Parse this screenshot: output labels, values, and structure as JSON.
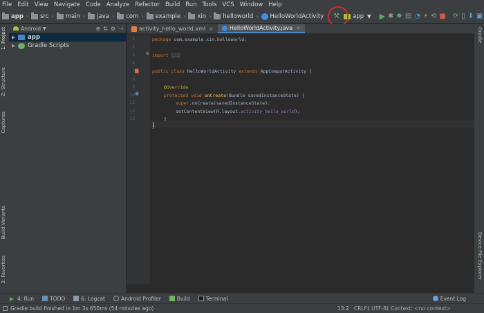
{
  "menu": [
    "File",
    "Edit",
    "View",
    "Navigate",
    "Code",
    "Analyze",
    "Refactor",
    "Build",
    "Run",
    "Tools",
    "VCS",
    "Window",
    "Help"
  ],
  "breadcrumb": [
    "app",
    "src",
    "main",
    "java",
    "com",
    "example",
    "xin",
    "helloworld",
    "HelloWorldActivity"
  ],
  "run_config": "app",
  "project_panel": {
    "view_mode": "Android",
    "items": [
      {
        "label": "app",
        "selected": true
      },
      {
        "label": "Gradle Scripts",
        "selected": false
      }
    ]
  },
  "left_tabs": [
    "1: Project",
    "Z: Structure",
    "Captures",
    "Build Variants",
    "2: Favorites"
  ],
  "right_tabs": [
    "Gradle",
    "Device File Explorer"
  ],
  "editor_tabs": [
    {
      "label": "activity_hello_world.xml",
      "active": false
    },
    {
      "label": "HelloWorldActivity.java",
      "active": true
    }
  ],
  "line_numbers": [
    "1",
    "2",
    "3",
    "6",
    "7",
    "8",
    "9",
    "10",
    "11",
    "12",
    "13"
  ],
  "code": {
    "l1_kw": "package",
    "l1_rest": " com.example.xin.helloworld;",
    "l3_kw": "import",
    "l3_fold": "...",
    "l6_kw": "public class",
    "l6_rest1": " HelloWorldActivity ",
    "l6_kw2": "extends",
    "l6_rest2": " AppCompatActivity {",
    "l8_ann": "@Override",
    "l9_kw": "protected void",
    "l9_fn": "onCreate",
    "l9_rest": "(Bundle savedInstanceState) {",
    "l10_kw": "super",
    "l10_rest": ".onCreate(savedInstanceState);",
    "l11_rest": "setContentView(R.layout.",
    "l11_ital": "activity_hello_world",
    "l11_end": ");",
    "l12": "}",
    "l13": "}"
  },
  "bottom_tools": [
    {
      "label": "4: Run",
      "icon": "run-icon"
    },
    {
      "label": "TODO",
      "icon": "todo-icon"
    },
    {
      "label": "6: Logcat",
      "icon": "logcat-icon"
    },
    {
      "label": "Android Profiler",
      "icon": "profiler-icon"
    },
    {
      "label": "Build",
      "icon": "build-icon"
    },
    {
      "label": "Terminal",
      "icon": "terminal-icon"
    }
  ],
  "event_log": "Event Log",
  "status": {
    "message": "Gradle build finished in 1m 3s 650ms (54 minutes ago)",
    "position": "13:2",
    "encoding": "CRLF‡  UTF-8‡  Context: <no context>"
  },
  "colors": {
    "run_highlight": "#d62a2a",
    "selection": "#0d293e",
    "keyword": "#cc7832",
    "annotation": "#bbb529"
  }
}
